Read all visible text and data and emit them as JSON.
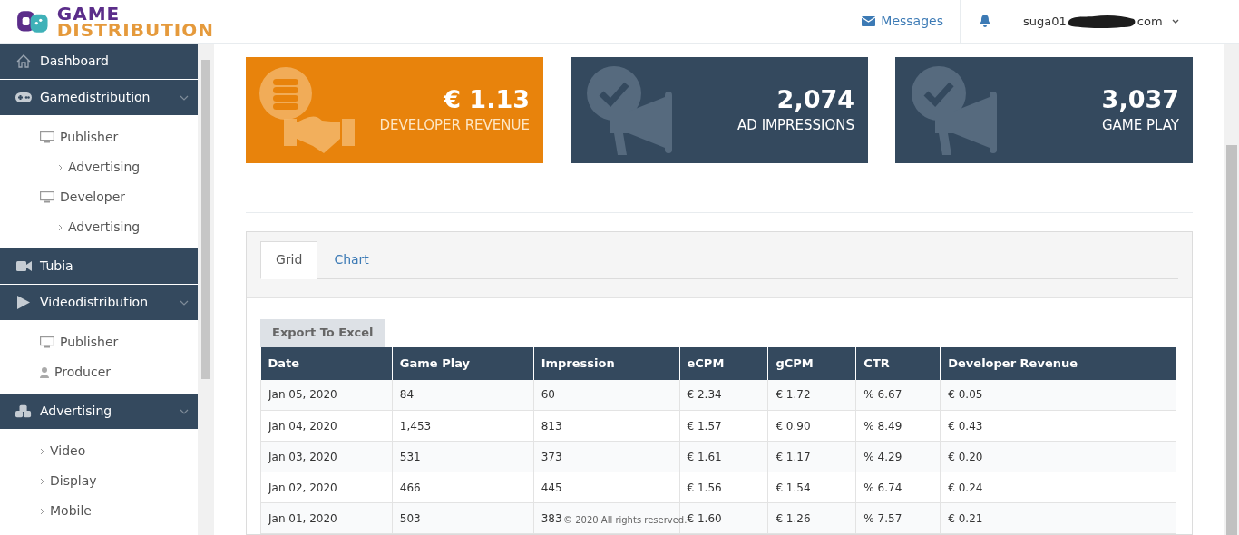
{
  "brand": {
    "line_1": "GAME",
    "line_2": "DISTRIBUTION"
  },
  "header": {
    "messages": "Messages",
    "email_start": "suga01",
    "email_end": "com"
  },
  "sidebar": {
    "items": [
      {
        "label": "Dashboard"
      },
      {
        "label": "Gamedistribution",
        "expanded": true,
        "children": [
          {
            "label": "Publisher",
            "children": [
              {
                "label": "Advertising"
              }
            ]
          },
          {
            "label": "Developer",
            "children": [
              {
                "label": "Advertising"
              }
            ]
          }
        ]
      },
      {
        "label": "Tubia"
      },
      {
        "label": "Videodistribution",
        "expanded": true,
        "children": [
          {
            "label": "Publisher"
          },
          {
            "label": "Producer"
          }
        ]
      },
      {
        "label": "Advertising",
        "expanded": true,
        "children": [
          {
            "label": "Video"
          },
          {
            "label": "Display"
          },
          {
            "label": "Mobile"
          }
        ]
      }
    ]
  },
  "stats": [
    {
      "value": "€ 1.13",
      "label": "DEVELOPER REVENUE",
      "kind": "revenue",
      "color": "#e8830c"
    },
    {
      "value": "2,074",
      "label": "AD IMPRESSIONS",
      "kind": "ads",
      "color": "#34495e"
    },
    {
      "value": "3,037",
      "label": "GAME PLAY",
      "kind": "ads",
      "color": "#34495e"
    }
  ],
  "tabs": [
    {
      "label": "Grid",
      "selected": true
    },
    {
      "label": "Chart",
      "selected": false
    }
  ],
  "export_button": "Export To Excel",
  "table": {
    "columns": [
      "Date",
      "Game Play",
      "Impression",
      "eCPM",
      "gCPM",
      "CTR",
      "Developer Revenue"
    ],
    "rows": [
      [
        "Jan 05, 2020",
        "84",
        "60",
        "€ 2.34",
        "€ 1.72",
        "% 6.67",
        "€ 0.05"
      ],
      [
        "Jan 04, 2020",
        "1,453",
        "813",
        "€ 1.57",
        "€ 0.90",
        "% 8.49",
        "€ 0.43"
      ],
      [
        "Jan 03, 2020",
        "531",
        "373",
        "€ 1.61",
        "€ 1.17",
        "% 4.29",
        "€ 0.20"
      ],
      [
        "Jan 02, 2020",
        "466",
        "445",
        "€ 1.56",
        "€ 1.54",
        "% 6.74",
        "€ 0.24"
      ],
      [
        "Jan 01, 2020",
        "503",
        "383",
        "€ 1.60",
        "€ 1.26",
        "% 7.57",
        "€ 0.21"
      ]
    ]
  },
  "footer": "© 2020 All rights reserved."
}
